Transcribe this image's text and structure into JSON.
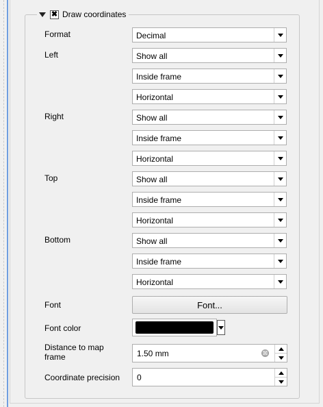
{
  "group": {
    "title": "Draw coordinates",
    "checked_mark": "✖"
  },
  "rows": [
    {
      "label": "Format",
      "combos": [
        "Decimal"
      ]
    },
    {
      "label": "Left",
      "combos": [
        "Show all",
        "Inside frame",
        "Horizontal"
      ]
    },
    {
      "label": "Right",
      "combos": [
        "Show all",
        "Inside frame",
        "Horizontal"
      ]
    },
    {
      "label": "Top",
      "combos": [
        "Show all",
        "Inside frame",
        "Horizontal"
      ]
    },
    {
      "label": "Bottom",
      "combos": [
        "Show all",
        "Inside frame",
        "Horizontal"
      ]
    }
  ],
  "font": {
    "label": "Font",
    "button": "Font..."
  },
  "font_color": {
    "label": "Font color",
    "value": "#000000"
  },
  "distance": {
    "label": "Distance to map frame",
    "value": "1.50 mm",
    "clear_glyph": "⊠"
  },
  "precision": {
    "label": "Coordinate precision",
    "value": "0"
  },
  "icons": {
    "collapse": "triangle-down-icon",
    "dropdown": "chevron-down-icon",
    "spin": "spin-arrows-icon"
  }
}
